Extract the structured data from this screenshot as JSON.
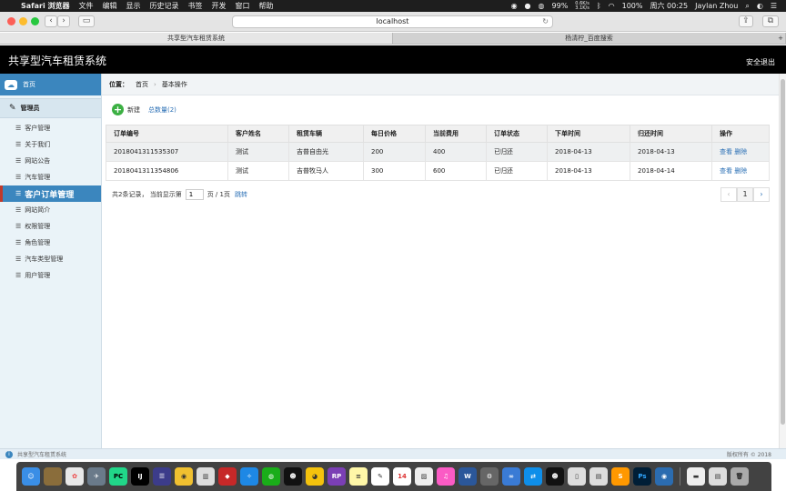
{
  "menubar": {
    "apple": "",
    "app_name": "Safari 浏览器",
    "menus": [
      "文件",
      "编辑",
      "显示",
      "历史记录",
      "书签",
      "开发",
      "窗口",
      "帮助"
    ],
    "battery": "99%",
    "net_up": "0.6K/s",
    "net_down": "3.1K/s",
    "battery_right": "100%",
    "datetime": "周六 00:25",
    "user": "Jaylan Zhou"
  },
  "browser": {
    "url": "localhost",
    "tabs": [
      "共享型汽车租赁系统",
      "杨清柠_百度搜索"
    ]
  },
  "app": {
    "title": "共享型汽车租赁系统",
    "logout": "安全退出"
  },
  "sidebar": {
    "home": "首页",
    "admin": "管理员",
    "items": [
      "客户管理",
      "关于我们",
      "网站公告",
      "汽车管理",
      "客户订单管理",
      "网站简介",
      "权限管理",
      "角色管理",
      "汽车类型管理",
      "用户管理"
    ],
    "active_index": 4
  },
  "breadcrumb": {
    "label": "位置：",
    "home": "首页",
    "current": "基本操作"
  },
  "actions": {
    "new": "新建",
    "total": "总数量(2)"
  },
  "table": {
    "headers": [
      "订单编号",
      "客户姓名",
      "租赁车辆",
      "每日价格",
      "当前费用",
      "订单状态",
      "下单时间",
      "归还时间",
      "操作"
    ],
    "rows": [
      [
        "2018041311535307",
        "测试",
        "吉普自由光",
        "200",
        "400",
        "已归还",
        "2018-04-13",
        "2018-04-13"
      ],
      [
        "2018041311354806",
        "测试",
        "吉普牧马人",
        "300",
        "600",
        "已归还",
        "2018-04-13",
        "2018-04-14"
      ]
    ],
    "op_view": "查看",
    "op_delete": "删除"
  },
  "pager": {
    "summary_prefix": "共",
    "summary_count": "2",
    "summary_suffix": "条记录，  当前显示第",
    "page_value": "1",
    "page_info": "页 / 1页",
    "jump": "跳转",
    "prev": "‹",
    "current": "1",
    "next": "›"
  },
  "footer": {
    "left": "共享型汽车租赁系统",
    "right": "版权所有 © 2018"
  },
  "dock": {
    "apps": [
      "Finder",
      "Launchpad",
      "Photos",
      "Safari",
      "PyCharm",
      "IntelliJ",
      "Sublime",
      "Chrome",
      "Redis",
      "QQ",
      "WeChat",
      "Axure",
      "Notes",
      "Calendar",
      "iTunes",
      "Word",
      "Preferences",
      "TeamViewer",
      "Photoshop",
      "Trash"
    ],
    "calendar_day": "14",
    "rp": "RP",
    "ps": "Ps",
    "pc": "PC",
    "ij": "IJ"
  },
  "colors": {
    "accent": "#3b86be",
    "header_bg": "#000000",
    "link": "#2a6fb5",
    "active_marker": "#c0392b",
    "add_green": "#3cb043"
  }
}
